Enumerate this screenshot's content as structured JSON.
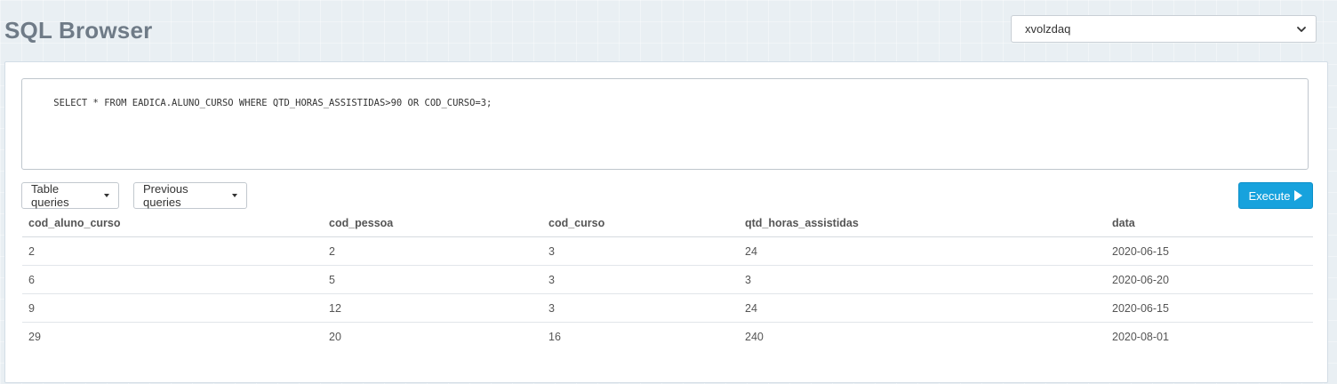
{
  "header": {
    "title": "SQL Browser",
    "database_select": {
      "value": "xvolzdaq"
    }
  },
  "query": {
    "text": "SELECT * FROM EADICA.ALUNO_CURSO WHERE QTD_HORAS_ASSISTIDAS>90 OR COD_CURSO=3;"
  },
  "toolbar": {
    "table_queries_label": "Table queries",
    "previous_queries_label": "Previous queries",
    "execute_label": "Execute"
  },
  "results": {
    "columns": [
      "cod_aluno_curso",
      "cod_pessoa",
      "cod_curso",
      "qtd_horas_assistidas",
      "data"
    ],
    "rows": [
      [
        "2",
        "2",
        "3",
        "24",
        "2020-06-15"
      ],
      [
        "6",
        "5",
        "3",
        "3",
        "2020-06-20"
      ],
      [
        "9",
        "12",
        "3",
        "24",
        "2020-06-15"
      ],
      [
        "29",
        "20",
        "16",
        "240",
        "2020-08-01"
      ]
    ]
  },
  "colors": {
    "accent": "#17a2dd",
    "title": "#6f7b87"
  }
}
